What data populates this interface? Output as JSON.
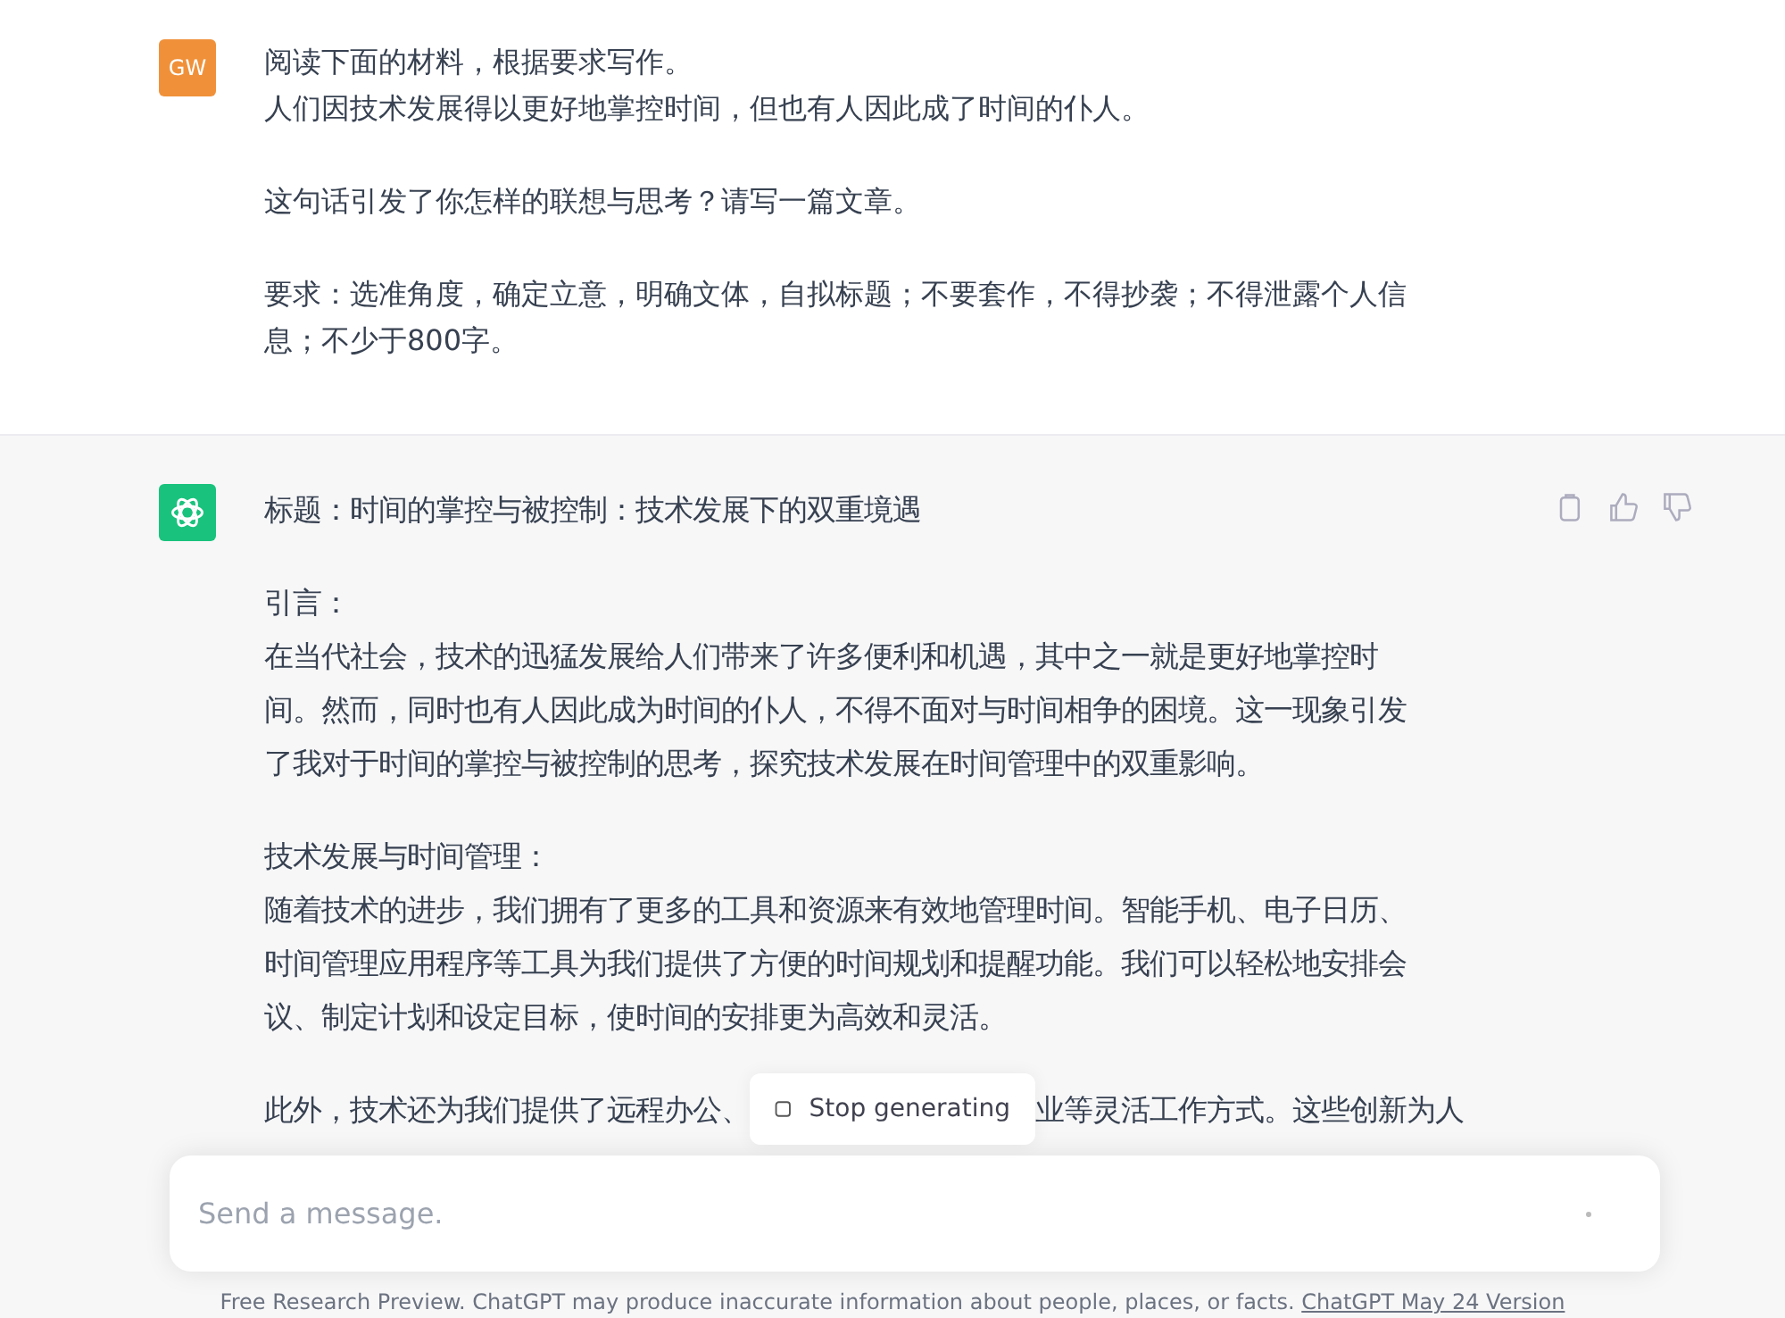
{
  "user_message": {
    "avatar": "GW",
    "paragraphs": [
      [
        "阅读下面的材料，根据要求写作。",
        "人们因技术发展得以更好地掌控时间，但也有人因此成了时间的仆人。"
      ],
      [
        "这句话引发了你怎样的联想与思考？请写一篇文章。"
      ],
      [
        "要求：选准角度，确定立意，明确文体，自拟标题；不要套作，不得抄袭；不得泄露个人信",
        "息；不少于800字。"
      ]
    ]
  },
  "assistant_message": {
    "paragraphs": [
      [
        "标题：时间的掌控与被控制：技术发展下的双重境遇"
      ],
      [
        "引言：",
        "在当代社会，技术的迅猛发展给人们带来了许多便利和机遇，其中之一就是更好地掌控时",
        "间。然而，同时也有人因此成为时间的仆人，不得不面对与时间相争的困境。这一现象引发",
        "了我对于时间的掌控与被控制的思考，探究技术发展在时间管理中的双重影响。"
      ],
      [
        "技术发展与时间管理：",
        "随着技术的进步，我们拥有了更多的工具和资源来有效地管理时间。智能手机、电子日历、",
        "时间管理应用程序等工具为我们提供了方便的时间规划和提醒功能。我们可以轻松地安排会",
        "议、制定计划和设定目标，使时间的安排更为高效和灵活。"
      ]
    ],
    "partial_line": {
      "before": "此外，技术还为我们提供了远程办公、",
      "after": "业等灵活工作方式。这些创新为人"
    }
  },
  "stop_button": {
    "label": "Stop generating"
  },
  "composer": {
    "placeholder": "Send a message."
  },
  "footer": {
    "text": "Free Research Preview. ChatGPT may produce inaccurate information about people, places, or facts.",
    "link": "ChatGPT May 24 Version"
  }
}
